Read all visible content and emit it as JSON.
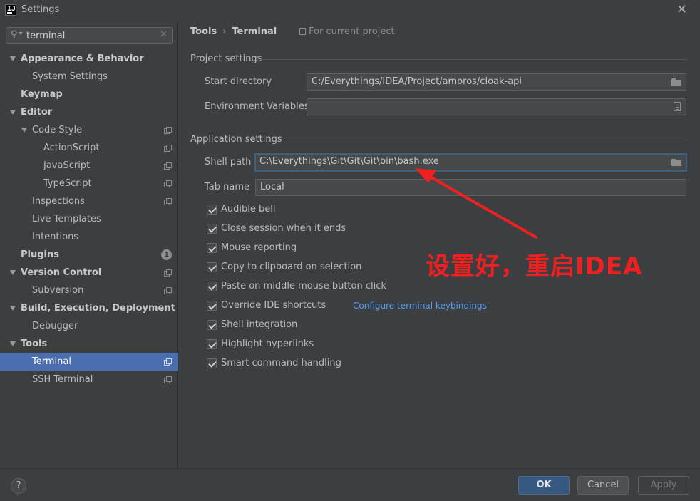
{
  "window": {
    "title": "Settings"
  },
  "search": {
    "value": "terminal"
  },
  "sidebar": {
    "items": [
      {
        "label": "Appearance & Behavior"
      },
      {
        "label": "System Settings"
      },
      {
        "label": "Keymap"
      },
      {
        "label": "Editor"
      },
      {
        "label": "Code Style"
      },
      {
        "label": "ActionScript"
      },
      {
        "label": "JavaScript"
      },
      {
        "label": "TypeScript"
      },
      {
        "label": "Inspections"
      },
      {
        "label": "Live Templates"
      },
      {
        "label": "Intentions"
      },
      {
        "label": "Plugins",
        "badge": "1"
      },
      {
        "label": "Version Control"
      },
      {
        "label": "Subversion"
      },
      {
        "label": "Build, Execution, Deployment"
      },
      {
        "label": "Debugger"
      },
      {
        "label": "Tools"
      },
      {
        "label": "Terminal",
        "selected": true
      },
      {
        "label": "SSH Terminal"
      }
    ]
  },
  "breadcrumb": {
    "parent": "Tools",
    "current": "Terminal",
    "separator": "›"
  },
  "scope": {
    "label": "For current project"
  },
  "project_settings": {
    "title": "Project settings",
    "start_directory": {
      "label": "Start directory",
      "value": "C:/Everythings/IDEA/Project/amoros/cloak-api"
    },
    "env_vars": {
      "label": "Environment Variables",
      "value": ""
    }
  },
  "app_settings": {
    "title": "Application settings",
    "shell_path": {
      "label": "Shell path",
      "value": "C:\\Everythings\\Git\\Git\\Git\\bin\\bash.exe"
    },
    "tab_name": {
      "label": "Tab name",
      "value": "Local"
    },
    "checkboxes": [
      {
        "label": "Audible bell",
        "checked": true
      },
      {
        "label": "Close session when it ends",
        "checked": true
      },
      {
        "label": "Mouse reporting",
        "checked": true
      },
      {
        "label": "Copy to clipboard on selection",
        "checked": true
      },
      {
        "label": "Paste on middle mouse button click",
        "checked": true
      },
      {
        "label": "Override IDE shortcuts",
        "checked": true
      },
      {
        "label": "Shell integration",
        "checked": true
      },
      {
        "label": "Highlight hyperlinks",
        "checked": true
      },
      {
        "label": "Smart command handling",
        "checked": true
      }
    ],
    "keybindings_link": "Configure terminal keybindings"
  },
  "annotation": {
    "text": "设置好，重启IDEA",
    "color": "#f02020"
  },
  "buttons": {
    "help": "?",
    "ok": "OK",
    "cancel": "Cancel",
    "apply": "Apply"
  },
  "colors": {
    "selection": "#4b6eaf",
    "link": "#589df6",
    "background": "#3c3f41"
  }
}
